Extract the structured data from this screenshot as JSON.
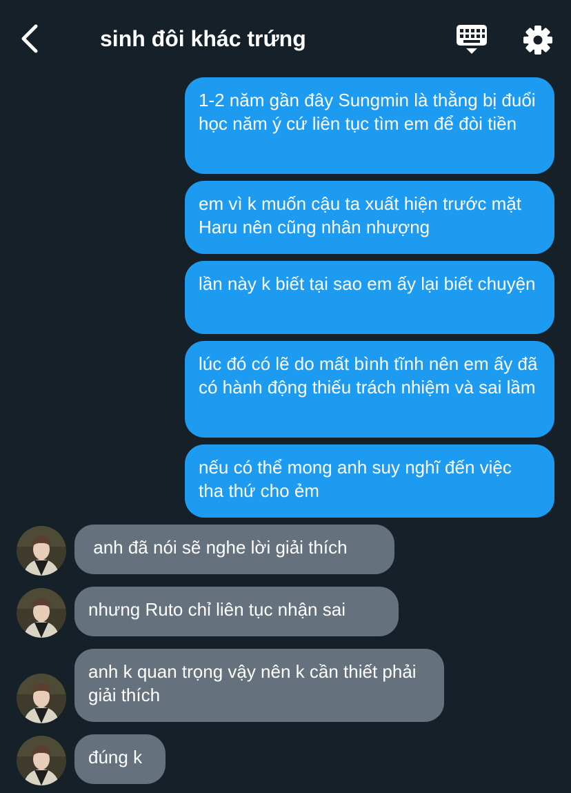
{
  "header": {
    "title": "sinh đôi khác trứng",
    "back_icon": "chevron-left-icon",
    "keyboard_icon": "keyboard-icon",
    "settings_icon": "gear-icon"
  },
  "colors": {
    "background": "#162029",
    "outgoing_bubble": "#1d9bf0",
    "incoming_bubble": "#65717d"
  },
  "messages": [
    {
      "side": "out",
      "text": "1-2 năm gần đây Sungmin là thằng bị đuổi học năm ý cứ liên tục tìm em để đòi tiền"
    },
    {
      "side": "out",
      "text": "em vì k muốn cậu ta xuất hiện trước mặt Haru nên cũng nhân nhượng"
    },
    {
      "side": "out",
      "text": "lần này k biết tại sao em ấy lại biết chuyện"
    },
    {
      "side": "out",
      "text": "lúc đó có lẽ do mất bình tĩnh nên em ấy đã có hành động thiếu trách nhiệm và sai lầm"
    },
    {
      "side": "out",
      "text": "nếu có thể mong anh suy nghĩ đến việc tha thứ cho ẻm"
    },
    {
      "side": "in",
      "text": " anh đã nói sẽ nghe lời giải thích"
    },
    {
      "side": "in",
      "text": "nhưng Ruto chỉ liên tục nhận sai"
    },
    {
      "side": "in",
      "text": "anh k quan trọng vậy nên k cần thiết phải giải thích"
    },
    {
      "side": "in",
      "text": "đúng k"
    }
  ]
}
